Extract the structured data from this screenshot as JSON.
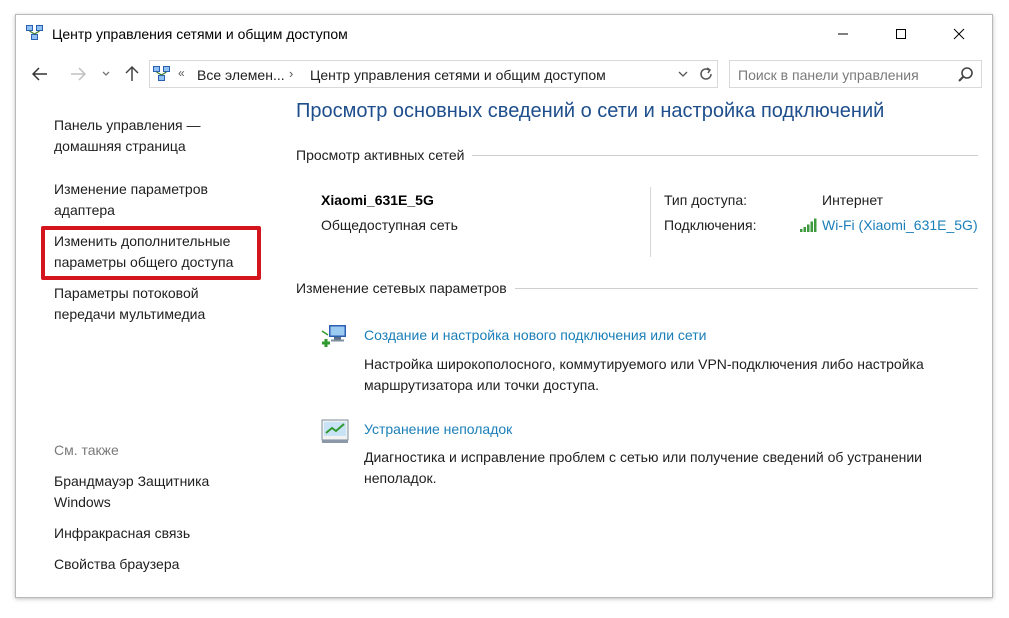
{
  "window": {
    "title": "Центр управления сетями и общим доступом"
  },
  "address": {
    "crumbs": [
      "Все элемен...",
      "Центр управления сетями и общим доступом"
    ]
  },
  "search": {
    "placeholder": "Поиск в панели управления"
  },
  "sidebar": {
    "links": [
      "Панель управления — домашняя страница",
      "Изменение параметров адаптера",
      "Изменить дополнительные параметры общего доступа",
      "Параметры потоковой передачи мультимедиа"
    ],
    "see_also_label": "См. также",
    "see_also": [
      "Брандмауэр Защитника Windows",
      "Инфракрасная связь",
      "Свойства браузера"
    ]
  },
  "main": {
    "title": "Просмотр основных сведений о сети и настройка подключений",
    "active_networks_header": "Просмотр активных сетей",
    "network": {
      "name": "Xiaomi_631E_5G",
      "category": "Общедоступная сеть",
      "access_type_label": "Тип доступа:",
      "access_type_value": "Интернет",
      "connections_label": "Подключения:",
      "connections_value": "Wi-Fi (Xiaomi_631E_5G)"
    },
    "change_settings_header": "Изменение сетевых параметров",
    "tasks": [
      {
        "link": "Создание и настройка нового подключения или сети",
        "desc": "Настройка широкополосного, коммутируемого или VPN-подключения либо настройка маршрутизатора или точки доступа."
      },
      {
        "link": "Устранение неполадок",
        "desc": "Диагностика и исправление проблем с сетью или получение сведений об устранении неполадок."
      }
    ]
  },
  "colors": {
    "link": "#1a7fb8",
    "title": "#1e4e8c",
    "highlight": "#d4151d",
    "signal": "#3c9a3c"
  }
}
